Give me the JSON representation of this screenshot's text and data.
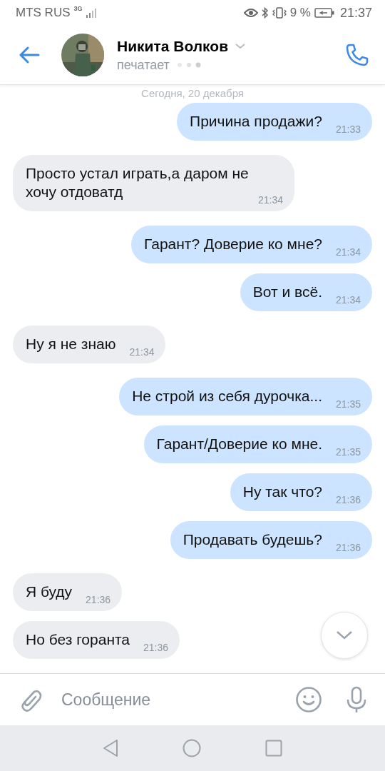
{
  "status_bar": {
    "carrier": "MTS RUS",
    "network": "3G",
    "battery": "9 %",
    "time": "21:37"
  },
  "header": {
    "name": "Никита Волков",
    "status": "печатает"
  },
  "date_divider": "Сегодня, 20 декабря",
  "messages": [
    {
      "kind": "outgoing",
      "text": "Причина продажи?",
      "time": "21:33"
    },
    {
      "kind": "incoming",
      "text": "Просто устал играть,а даром не хочу отдоватд",
      "time": "21:34"
    },
    {
      "kind": "outgoing",
      "text": "Гарант? Доверие ко мне?",
      "time": "21:34"
    },
    {
      "kind": "outgoing",
      "text": "Вот и всё.",
      "time": "21:34"
    },
    {
      "kind": "incoming",
      "text": "Ну я не знаю",
      "time": "21:34"
    },
    {
      "kind": "outgoing",
      "text": "Не строй из себя дурочка...",
      "time": "21:35"
    },
    {
      "kind": "outgoing",
      "text": "Гарант/Доверие ко мне.",
      "time": "21:35"
    },
    {
      "kind": "outgoing",
      "text": "Ну так что?",
      "time": "21:36"
    },
    {
      "kind": "outgoing",
      "text": "Продавать будешь?",
      "time": "21:36"
    },
    {
      "kind": "incoming",
      "text": "Я буду",
      "time": "21:36"
    },
    {
      "kind": "incoming",
      "text": "Но без горанта",
      "time": "21:36"
    }
  ],
  "composer": {
    "placeholder": "Сообщение"
  }
}
